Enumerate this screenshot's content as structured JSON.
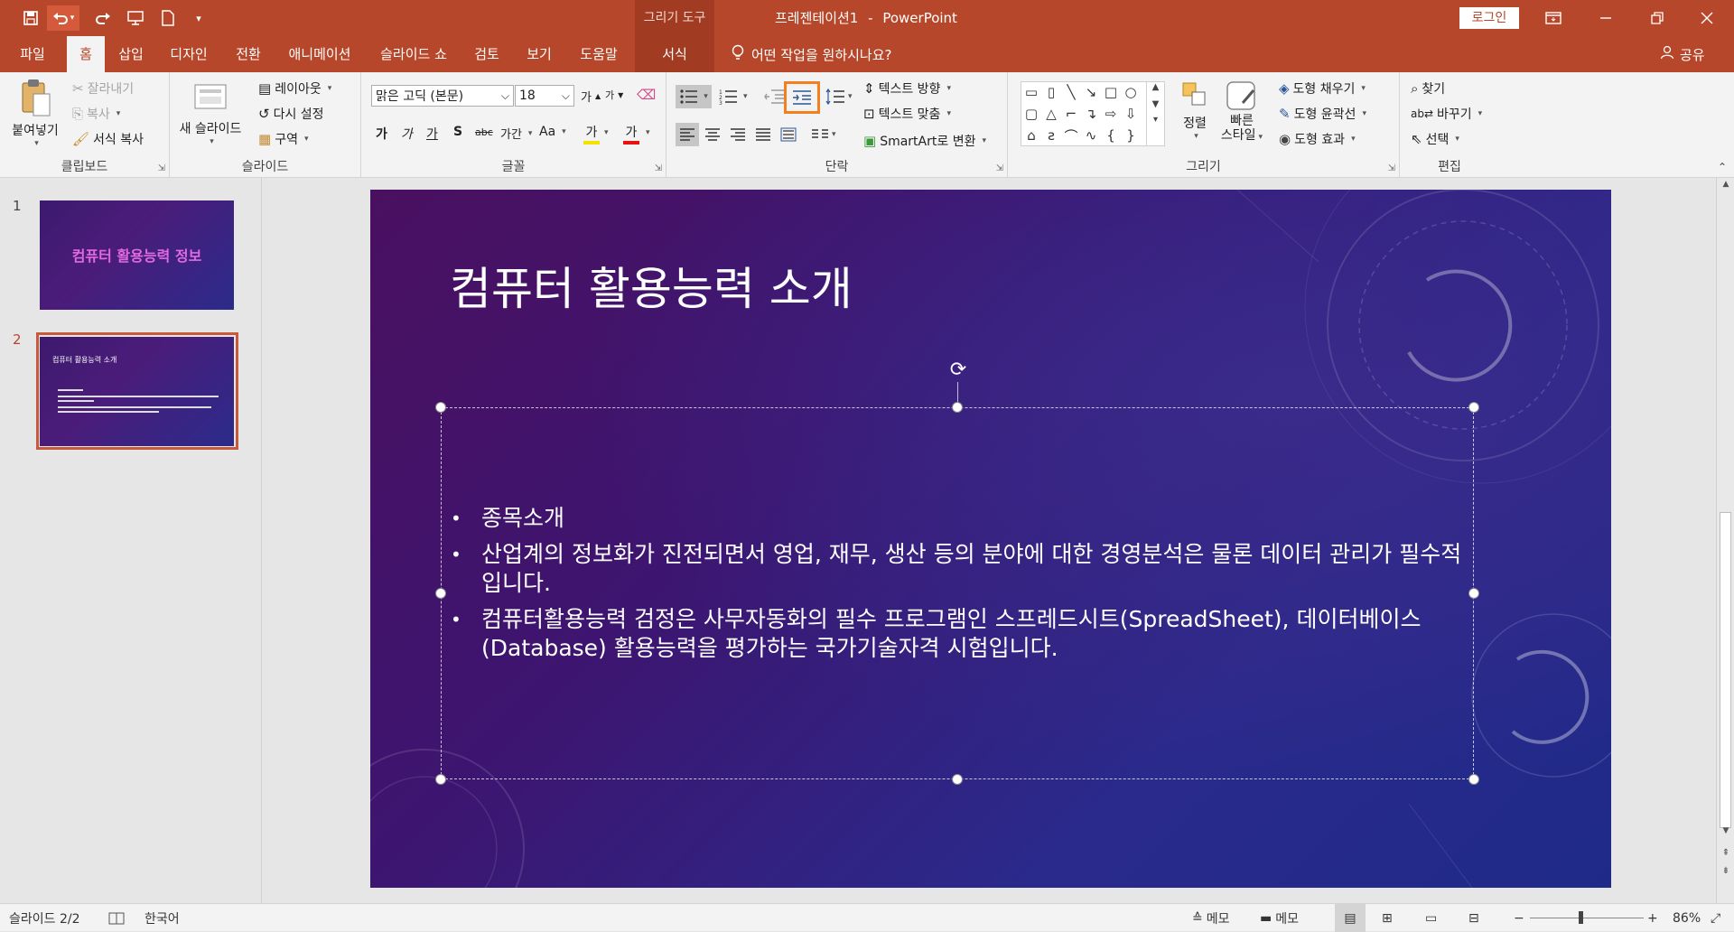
{
  "titlebar": {
    "context_tab": "그리기 도구",
    "doc_title": "프레젠테이션1",
    "separator": "-",
    "app_name": "PowerPoint",
    "login": "로그인"
  },
  "tabs": {
    "file": "파일",
    "home": "홈",
    "insert": "삽입",
    "design": "디자인",
    "transitions": "전환",
    "animations": "애니메이션",
    "slideshow": "슬라이드 쇼",
    "review": "검토",
    "view": "보기",
    "help": "도움말",
    "format": "서식",
    "tell_me": "어떤 작업을 원하시나요?",
    "share": "공유"
  },
  "clipboard": {
    "paste": "붙여넣기",
    "cut": "잘라내기",
    "copy": "복사",
    "format_painter": "서식 복사",
    "label": "클립보드"
  },
  "slides": {
    "new_slide_line1": "새 슬라이드",
    "layout": "레이아웃",
    "reset": "다시 설정",
    "section": "구역",
    "label": "슬라이드"
  },
  "font": {
    "name": "맑은 고딕 (본문)",
    "size": "18",
    "grow": "가",
    "shrink": "가",
    "bold": "가",
    "italic": "가",
    "underline": "가",
    "shadow": "S",
    "strike": "abc",
    "spacing": "가간",
    "case": "Aa",
    "highlight": "가",
    "color": "가",
    "label": "글꼴"
  },
  "paragraph": {
    "text_direction": "텍스트 방향",
    "align_text": "텍스트 맞춤",
    "smartart": "SmartArt로 변환",
    "label": "단락"
  },
  "drawing": {
    "arrange": "정렬",
    "quick_styles_line1": "빠른",
    "quick_styles_line2": "스타일",
    "fill": "도형 채우기",
    "outline": "도형 윤곽선",
    "effects": "도형 효과",
    "label": "그리기"
  },
  "editing": {
    "find": "찾기",
    "replace": "바꾸기",
    "select": "선택",
    "label": "편집"
  },
  "thumbnails": [
    {
      "number": "1",
      "title": "컴퓨터 활용능력 정보"
    },
    {
      "number": "2",
      "title": "컴퓨터 활용능력 소개"
    }
  ],
  "slide": {
    "title": "컴퓨터 활용능력 소개",
    "bullets": [
      "종목소개",
      "산업계의 정보화가 진전되면서 영업, 재무, 생산 등의 분야에 대한 경영분석은 물론 데이터 관리가 필수적 입니다.",
      "컴퓨터활용능력 검정은 사무자동화의 필수 프로그램인 스프레드시트(SpreadSheet), 데이터베이스(Database) 활용능력을 평가하는 국가기술자격 시험입니다."
    ]
  },
  "status": {
    "slide_info": "슬라이드 2/2",
    "language": "한국어",
    "notes1": "메모",
    "notes2": "메모",
    "zoom": "86%"
  },
  "colors": {
    "accent": "#b7472a",
    "highlight_box": "#f08020"
  },
  "icons": [
    "save-icon",
    "undo-icon",
    "redo-icon",
    "present-icon",
    "new-icon",
    "customize-icon",
    "lightbulb-icon",
    "user-icon",
    "ribbon-display-icon",
    "minimize-icon",
    "restore-icon",
    "close-icon"
  ]
}
